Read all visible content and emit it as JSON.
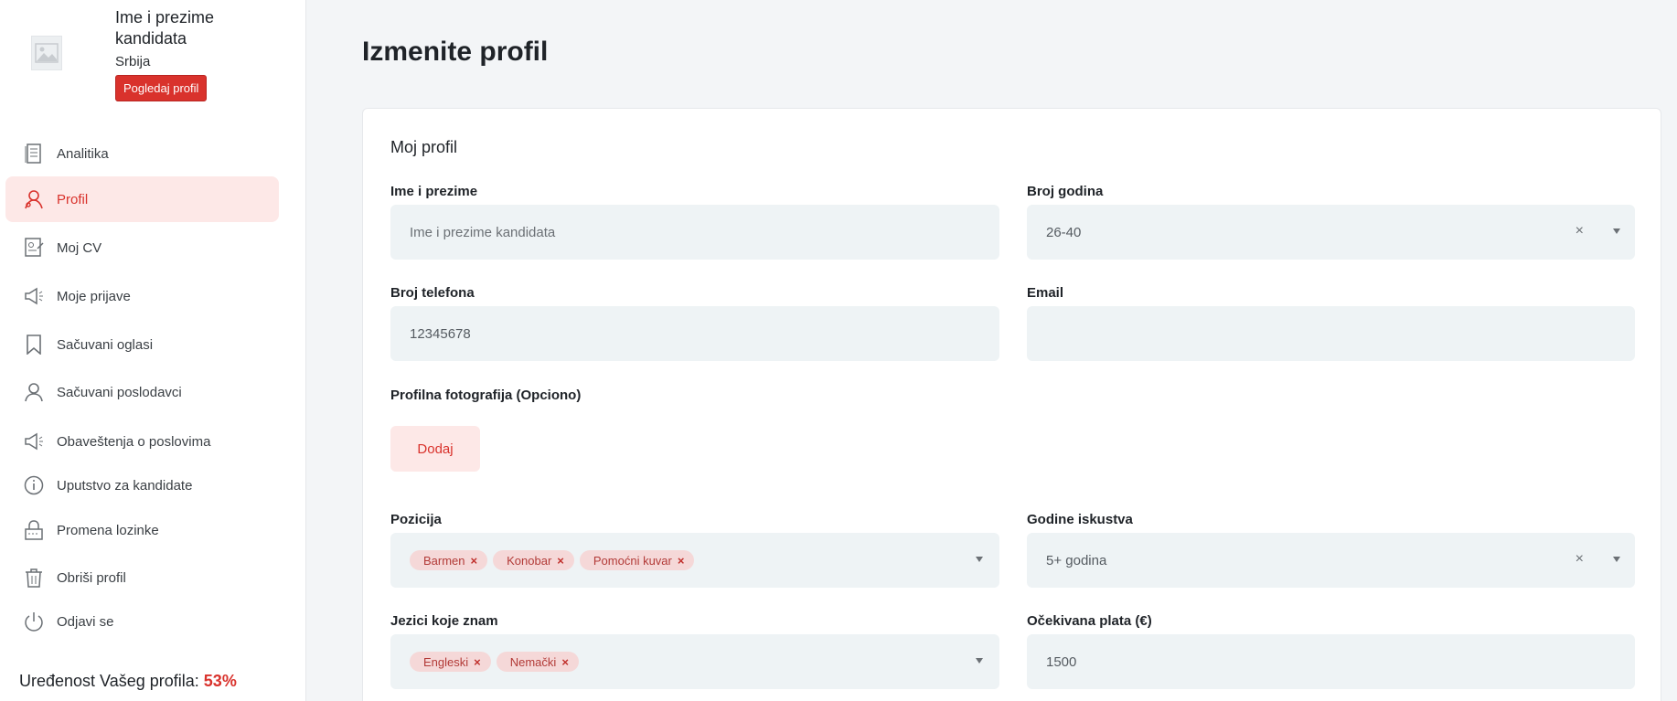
{
  "user": {
    "name": "Ime i prezime kandidata",
    "country": "Srbija",
    "view_profile_label": "Pogledaj profil"
  },
  "nav": {
    "items": [
      {
        "label": "Analitika",
        "icon": "analytics-icon"
      },
      {
        "label": "Profil",
        "icon": "profile-icon",
        "active": true
      },
      {
        "label": "Moj CV",
        "icon": "cv-icon"
      },
      {
        "label": "Moje prijave",
        "icon": "megaphone-icon"
      },
      {
        "label": "Sačuvani oglasi",
        "icon": "bookmark-icon"
      },
      {
        "label": "Sačuvani poslodavci",
        "icon": "user-icon"
      },
      {
        "label": "Obaveštenja o poslovima",
        "icon": "megaphone-icon"
      },
      {
        "label": "Uputstvo za kandidate",
        "icon": "info-icon"
      },
      {
        "label": "Promena lozinke",
        "icon": "lock-icon"
      },
      {
        "label": "Obriši profil",
        "icon": "trash-icon"
      },
      {
        "label": "Odjavi se",
        "icon": "power-icon"
      }
    ]
  },
  "completeness": {
    "label": "Uređenost Vašeg profila:",
    "value": "53%"
  },
  "page": {
    "title": "Izmenite profil",
    "section_title": "Moj profil"
  },
  "form": {
    "name": {
      "label": "Ime i prezime",
      "placeholder": "Ime i prezime kandidata"
    },
    "age": {
      "label": "Broj godina",
      "value": "26-40"
    },
    "phone": {
      "label": "Broj telefona",
      "value": "12345678"
    },
    "email": {
      "label": "Email",
      "value": ""
    },
    "photo": {
      "label": "Profilna fotografija (Opciono)",
      "button": "Dodaj"
    },
    "position": {
      "label": "Pozicija",
      "tags": [
        "Barmen",
        "Konobar",
        "Pomoćni kuvar"
      ]
    },
    "experience": {
      "label": "Godine iskustva",
      "value": "5+ godina"
    },
    "languages": {
      "label": "Jezici koje znam",
      "tags": [
        "Engleski",
        "Nemački"
      ]
    },
    "salary": {
      "label": "Očekivana plata (€)",
      "value": "1500"
    }
  },
  "colors": {
    "accent": "#d9322c",
    "accent_soft": "#fde8e7",
    "input_bg": "#eef3f5",
    "tag_bg": "#f5d8d8"
  }
}
